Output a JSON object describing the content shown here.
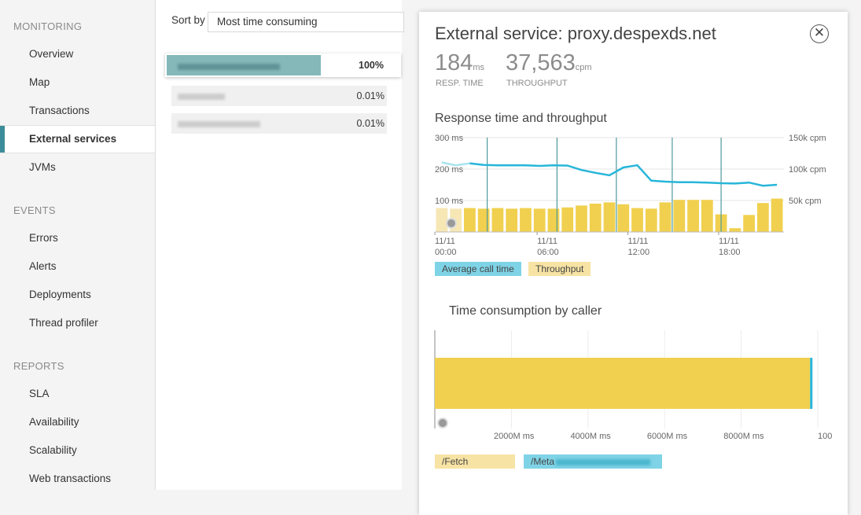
{
  "sidebar": {
    "sections": [
      {
        "heading": "MONITORING",
        "items": [
          "Overview",
          "Map",
          "Transactions",
          "External services",
          "JVMs"
        ]
      },
      {
        "heading": "EVENTS",
        "items": [
          "Errors",
          "Alerts",
          "Deployments",
          "Thread profiler"
        ]
      },
      {
        "heading": "REPORTS",
        "items": [
          "SLA",
          "Availability",
          "Scalability",
          "Web transactions"
        ]
      }
    ],
    "active_item": "External services"
  },
  "list": {
    "sort_label": "Sort by",
    "sort_value": "Most time consuming",
    "rows": [
      {
        "percent": "100%",
        "fill": 1.0
      },
      {
        "percent": "0.01%",
        "fill": 0.0001
      },
      {
        "percent": "0.01%",
        "fill": 0.0001
      }
    ]
  },
  "panel": {
    "title": "External service: proxy.despexds.net",
    "close_icon": "close-circle-icon",
    "kpis": {
      "resp_time": {
        "value": "184",
        "unit": "ms",
        "label": "RESP. TIME"
      },
      "throughput": {
        "value": "37,563",
        "unit": "cpm",
        "label": "THROUGHPUT"
      }
    },
    "chart1_title": "Response time and throughput",
    "chart2_title": "Time consumption by caller",
    "legend1": [
      {
        "label": "Average call time",
        "color": "#7fd3e6"
      },
      {
        "label": "Throughput",
        "color": "#f7e3a4"
      }
    ],
    "legend2": [
      {
        "label": "/Fetch",
        "color": "#f7e3a4"
      },
      {
        "label": "/Meta",
        "color": "#7fd3e6"
      }
    ]
  },
  "chart_data": [
    {
      "type": "bar",
      "title": "Response time and throughput",
      "left_ticks": [
        "300 ms",
        "200 ms",
        "100 ms"
      ],
      "right_ticks": [
        "150k cpm",
        "100k cpm",
        "50k cpm"
      ],
      "x_ticks": [
        [
          "11/11",
          "00:00"
        ],
        [
          "11/11",
          "06:00"
        ],
        [
          "11/11",
          "12:00"
        ],
        [
          "11/11",
          "18:00"
        ]
      ],
      "ylim_ms": [
        0,
        300
      ],
      "ylim_cpm": [
        0,
        150000
      ],
      "series": [
        {
          "name": "Throughput",
          "axis": "right",
          "color": "#f0d04e",
          "values": [
            38000,
            37000,
            38000,
            37000,
            38000,
            37000,
            38000,
            37000,
            37000,
            39000,
            42000,
            45000,
            47000,
            44000,
            38000,
            37000,
            47000,
            51000,
            51000,
            51000,
            28000,
            6000,
            27000,
            46000,
            53000
          ]
        },
        {
          "name": "Average call time",
          "axis": "left",
          "color": "#27b6d9",
          "values": [
            221,
            212,
            218,
            213,
            212,
            212,
            212,
            210,
            212,
            211,
            197,
            188,
            180,
            205,
            212,
            163,
            160,
            158,
            158,
            157,
            155,
            154,
            157,
            147,
            150
          ]
        }
      ],
      "vertical_markers": [
        0.15,
        0.35,
        0.52,
        0.68,
        0.82
      ]
    },
    {
      "type": "bar",
      "title": "Time consumption by caller",
      "x_ticks": [
        "2000M ms",
        "4000M ms",
        "6000M ms",
        "8000M ms",
        "100"
      ],
      "xlim": [
        0,
        10000
      ],
      "series": [
        {
          "name": "/Fetch",
          "value": 9800,
          "color": "#f0d04e"
        },
        {
          "name": "/Meta",
          "value": 50,
          "color": "#27b6d9"
        }
      ]
    }
  ]
}
